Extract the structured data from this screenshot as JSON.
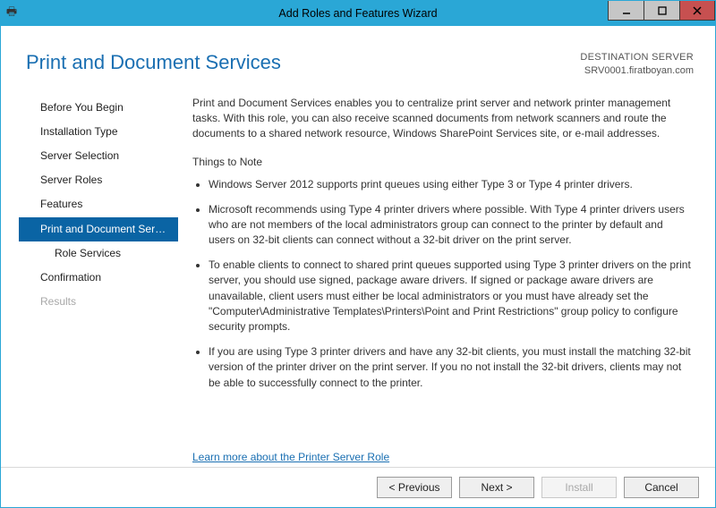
{
  "window": {
    "title": "Add Roles and Features Wizard"
  },
  "header": {
    "heading": "Print and Document Services",
    "dest_label": "DESTINATION SERVER",
    "dest_value": "SRV0001.firatboyan.com"
  },
  "nav": {
    "items": [
      {
        "label": "Before You Begin",
        "selected": false,
        "disabled": false,
        "sub": false
      },
      {
        "label": "Installation Type",
        "selected": false,
        "disabled": false,
        "sub": false
      },
      {
        "label": "Server Selection",
        "selected": false,
        "disabled": false,
        "sub": false
      },
      {
        "label": "Server Roles",
        "selected": false,
        "disabled": false,
        "sub": false
      },
      {
        "label": "Features",
        "selected": false,
        "disabled": false,
        "sub": false
      },
      {
        "label": "Print and Document Servi...",
        "selected": true,
        "disabled": false,
        "sub": false
      },
      {
        "label": "Role Services",
        "selected": false,
        "disabled": false,
        "sub": true
      },
      {
        "label": "Confirmation",
        "selected": false,
        "disabled": false,
        "sub": false
      },
      {
        "label": "Results",
        "selected": false,
        "disabled": true,
        "sub": false
      }
    ]
  },
  "content": {
    "intro": "Print and Document Services enables you to centralize print server and network printer management tasks. With this role, you can also receive scanned documents from network scanners and route the documents to a shared network resource, Windows SharePoint Services site, or e-mail addresses.",
    "things_heading": "Things to Note",
    "bullets": [
      "Windows Server 2012 supports print queues using either Type 3 or Type 4 printer drivers.",
      "Microsoft recommends using Type 4 printer drivers where possible. With Type 4 printer drivers users who are not members of the local administrators group can connect to the printer by default and users on 32-bit clients can connect without a 32-bit driver on the print server.",
      "To enable clients to connect to shared print queues supported using Type 3 printer drivers on the print server, you should use signed, package aware drivers. If signed or package aware drivers are unavailable, client users must either be local administrators or you must have already set the \"Computer\\Administrative Templates\\Printers\\Point and Print Restrictions\" group policy to configure security prompts.",
      "If you are using Type 3 printer drivers and have any 32-bit clients, you must install the matching 32-bit version of the printer driver on the print server. If you no not install the 32-bit drivers, clients may not be able to successfully connect to the printer."
    ],
    "learn_more": "Learn more about the Printer Server Role"
  },
  "footer": {
    "previous": "< Previous",
    "next": "Next >",
    "install": "Install",
    "cancel": "Cancel"
  }
}
